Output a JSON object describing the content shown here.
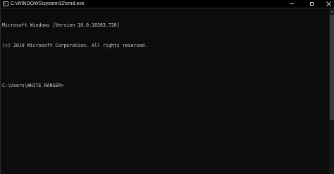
{
  "window": {
    "title": "C:\\WINDOWS\\system32\\cmd.exe",
    "icon": "console-app-icon",
    "controls": {
      "minimize": "minimize-icon",
      "maximize": "maximize-icon",
      "close": "close-icon"
    }
  },
  "console": {
    "lines": [
      "Microsoft Windows [Version 10.0.18363.720]",
      "(c) 2019 Microsoft Corporation. All rights reserved.",
      "",
      "C:\\Users\\WHITE RANGER>"
    ],
    "text_color": "#cccccc",
    "background_color": "#0c0c0c"
  }
}
